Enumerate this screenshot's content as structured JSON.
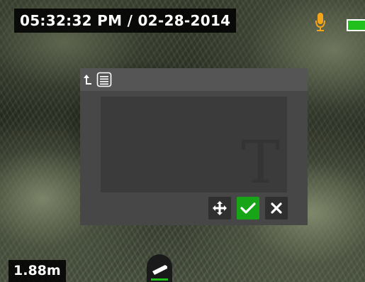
{
  "overlay": {
    "timestamp": "05:32:32 PM / 02-28-2014",
    "distance": "1.88m",
    "battery_color": "#22c01c",
    "mic_color": "#f2a51a"
  },
  "dialog": {
    "back_icon": "return-arrow-icon",
    "list_icon": "list-icon",
    "text_placeholder_glyph": "T",
    "buttons": [
      {
        "name": "move",
        "icon": "move-arrows-icon",
        "color": "#2f2f2f"
      },
      {
        "name": "confirm",
        "icon": "checkmark-icon",
        "color": "#17a517"
      },
      {
        "name": "cancel",
        "icon": "close-icon",
        "color": "#2f2f2f"
      }
    ]
  }
}
